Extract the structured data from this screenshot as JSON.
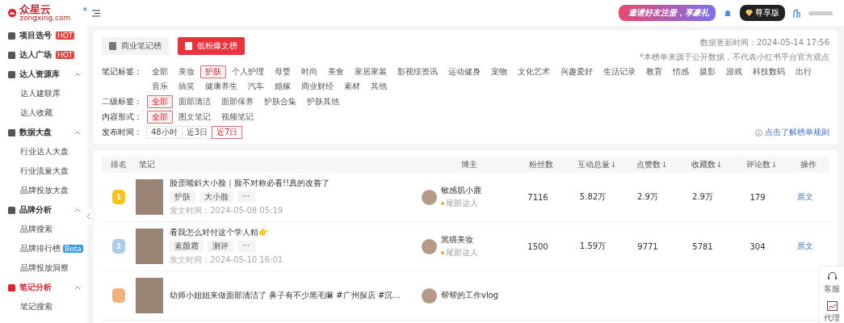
{
  "logo": {
    "name": "众星云",
    "domain": "zongxing.com"
  },
  "header": {
    "promo": "邀请好友注册，享豪礼",
    "vip": "尊享版"
  },
  "sidebar": {
    "items": [
      {
        "label": "项目选号",
        "badge": "HOT",
        "selected": false
      },
      {
        "label": "达人广场",
        "badge": "HOT",
        "selected": false
      },
      {
        "label": "达人资源库",
        "expanded": true,
        "selected": false,
        "children": [
          {
            "label": "达人建联库"
          },
          {
            "label": "达人收藏"
          }
        ]
      },
      {
        "label": "数据大盘",
        "expanded": true,
        "selected": false,
        "children": [
          {
            "label": "行业达人大盘"
          },
          {
            "label": "行业流量大盘"
          },
          {
            "label": "品牌投放大盘"
          }
        ]
      },
      {
        "label": "品牌分析",
        "expanded": true,
        "selected": false,
        "children": [
          {
            "label": "品牌搜索"
          },
          {
            "label": "品牌排行榜",
            "badge": "Beta"
          },
          {
            "label": "品牌投放洞察"
          }
        ]
      },
      {
        "label": "笔记分析",
        "expanded": true,
        "selected": true,
        "children": [
          {
            "label": "笔记搜索"
          }
        ]
      }
    ]
  },
  "board_tabs": [
    {
      "label": "商业笔记榜",
      "selected": false
    },
    {
      "label": "低粉爆文榜",
      "selected": true
    }
  ],
  "update_time": "数据更新时间：2024-05-14 17:56",
  "disclaimer": "*本榜单来源于公开数据，不代表小红书平台官方观点",
  "rules_link": "点击了解榜单规则",
  "filters": [
    {
      "label": "笔记标签：",
      "kind": "tags",
      "options": [
        {
          "label": "全部",
          "selected": false
        },
        {
          "label": "美妆",
          "selected": false
        },
        {
          "label": "护肤",
          "selected": true
        },
        {
          "label": "个人护理",
          "selected": false
        },
        {
          "label": "母婴",
          "selected": false
        },
        {
          "label": "时尚",
          "selected": false
        },
        {
          "label": "美食",
          "selected": false
        },
        {
          "label": "家居家装",
          "selected": false
        },
        {
          "label": "影视综资讯",
          "selected": false
        },
        {
          "label": "运动健身",
          "selected": false
        },
        {
          "label": "宠物",
          "selected": false
        },
        {
          "label": "文化艺术",
          "selected": false
        },
        {
          "label": "兴趣爱好",
          "selected": false
        },
        {
          "label": "生活记录",
          "selected": false
        },
        {
          "label": "教育",
          "selected": false
        },
        {
          "label": "情感",
          "selected": false
        },
        {
          "label": "摄影",
          "selected": false
        },
        {
          "label": "游戏",
          "selected": false
        },
        {
          "label": "科技数码",
          "selected": false
        },
        {
          "label": "出行",
          "selected": false
        },
        {
          "label": "音乐",
          "selected": false
        },
        {
          "label": "搞笑",
          "selected": false
        },
        {
          "label": "健康养生",
          "selected": false
        },
        {
          "label": "汽车",
          "selected": false
        },
        {
          "label": "婚嫁",
          "selected": false
        },
        {
          "label": "商业财经",
          "selected": false
        },
        {
          "label": "素材",
          "selected": false
        },
        {
          "label": "其他",
          "selected": false
        }
      ]
    },
    {
      "label": "二级标签：",
      "kind": "tags",
      "options": [
        {
          "label": "全部",
          "selected": true
        },
        {
          "label": "面部清洁",
          "selected": false
        },
        {
          "label": "面部保养",
          "selected": false
        },
        {
          "label": "护肤合集",
          "selected": false
        },
        {
          "label": "护肤其他",
          "selected": false
        }
      ]
    },
    {
      "label": "内容形式：",
      "kind": "tags",
      "options": [
        {
          "label": "全部",
          "selected": true
        },
        {
          "label": "图文笔记",
          "selected": false
        },
        {
          "label": "视频笔记",
          "selected": false
        }
      ]
    },
    {
      "label": "发布时间：",
      "kind": "segmented",
      "options": [
        {
          "label": "48小时",
          "selected": false
        },
        {
          "label": "近3日",
          "selected": false
        },
        {
          "label": "近7日",
          "selected": true
        }
      ]
    }
  ],
  "table": {
    "columns": [
      {
        "label": "排名",
        "sortable": false
      },
      {
        "label": "笔记",
        "sortable": false
      },
      {
        "label": "博主",
        "sortable": false
      },
      {
        "label": "粉丝数",
        "sortable": false
      },
      {
        "label": "互动总量",
        "sortable": true
      },
      {
        "label": "点赞数",
        "sortable": true
      },
      {
        "label": "收藏数",
        "sortable": true
      },
      {
        "label": "评论数",
        "sortable": true
      },
      {
        "label": "操作",
        "sortable": false
      }
    ],
    "rows": [
      {
        "rank": "1",
        "kind": "gold",
        "title": "脸歪嘴斜大小脸｜脸不对称必看!!真的改善了",
        "tags": [
          "护肤",
          "大小脸",
          "···"
        ],
        "time": "发文时间：2024-05-08 05:19",
        "blogger": "敏感肌小鹿",
        "level": "尾部达人",
        "fans": "7116",
        "interactions": "5.82万",
        "likes": "2.9万",
        "favorites": "2.9万",
        "comments": "179",
        "action": "原文"
      },
      {
        "rank": "2",
        "kind": "silver",
        "title": "看我怎么对付这个学人精👉",
        "tags": [
          "素颜霜",
          "测评",
          "···"
        ],
        "time": "发文时间：2024-05-10 16:01",
        "blogger": "黑猫美妆",
        "level": "尾部达人",
        "fans": "1500",
        "interactions": "1.59万",
        "likes": "9771",
        "favorites": "5781",
        "comments": "304",
        "action": "原文"
      },
      {
        "kind": "bronze",
        "title": "幼师小姐姐来做面部清洁了 鼻子有不少黑毛嘛 #广州探店 #沉...",
        "blogger": "帮帮的工作vlog"
      }
    ]
  },
  "float_panel": [
    {
      "label": "客服",
      "kind": "headset"
    },
    {
      "label": "代理",
      "kind": "chart"
    }
  ]
}
